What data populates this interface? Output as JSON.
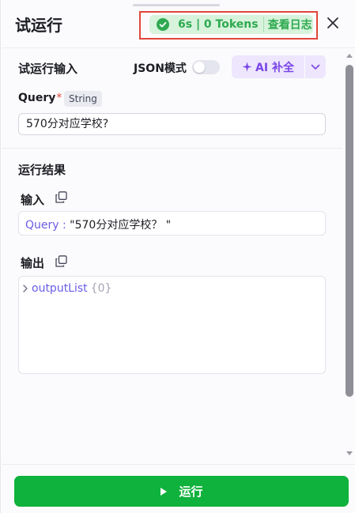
{
  "header": {
    "title": "试运行",
    "status": {
      "text": "6s | 0 Tokens",
      "log_link": "查看日志",
      "color": "#2ea94f",
      "background": "#d7f3dc"
    },
    "close_icon": "close-icon",
    "highlight_color": "#e0463a"
  },
  "input_section": {
    "title": "试运行输入",
    "json_mode_label": "JSON模式",
    "json_mode_on": false,
    "ai_button_label": "AI 补全",
    "ai_icon": "sparkle-icon",
    "query": {
      "label": "Query",
      "required_mark": "*",
      "type": "String",
      "value": "570分对应学校?"
    }
  },
  "result_section": {
    "title": "运行结果",
    "input": {
      "label": "输入",
      "key": "Query :",
      "value": "\"570分对应学校？ \""
    },
    "output": {
      "label": "输出",
      "key": "outputList",
      "count": "{0}"
    }
  },
  "footer": {
    "run_label": "运行",
    "run_color": "#0fb23c"
  }
}
